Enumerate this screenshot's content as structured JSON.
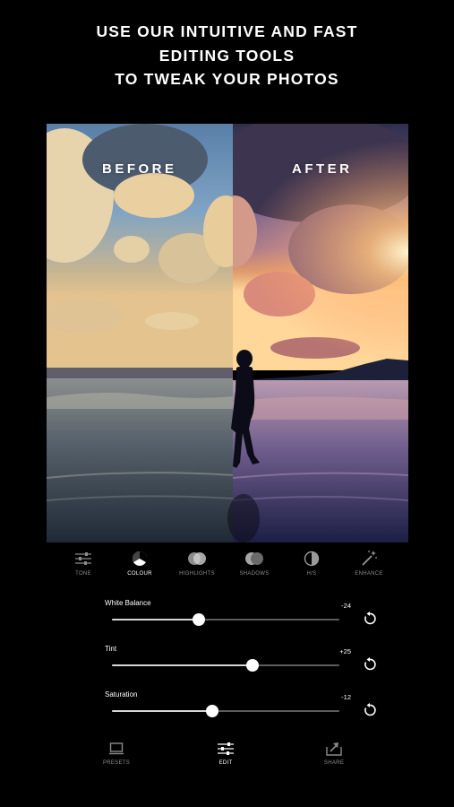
{
  "headline": {
    "line1": "USE OUR INTUITIVE AND FAST",
    "line2": "EDITING TOOLS",
    "line3": "TO TWEAK YOUR PHOTOS"
  },
  "comparison": {
    "before_label": "BEFORE",
    "after_label": "AFTER"
  },
  "tools": [
    {
      "label": "TONE",
      "icon": "sliders-icon",
      "active": false
    },
    {
      "label": "COLOUR",
      "icon": "colour-wheel-icon",
      "active": true
    },
    {
      "label": "HIGHLIGHTS",
      "icon": "highlights-icon",
      "active": false
    },
    {
      "label": "SHADOWS",
      "icon": "shadows-icon",
      "active": false
    },
    {
      "label": "H/S",
      "icon": "half-circle-icon",
      "active": false
    },
    {
      "label": "ENHANCE",
      "icon": "magic-wand-icon",
      "active": false
    }
  ],
  "sliders": [
    {
      "name": "White Balance",
      "value": "-24",
      "position": 0.38
    },
    {
      "name": "Tint",
      "value": "+25",
      "position": 0.62
    },
    {
      "name": "Saturation",
      "value": "-12",
      "position": 0.44
    }
  ],
  "bottom_nav": [
    {
      "label": "PRESETS",
      "icon": "presets-icon",
      "active": false
    },
    {
      "label": "EDIT",
      "icon": "edit-sliders-icon",
      "active": true
    },
    {
      "label": "SHARE",
      "icon": "share-icon",
      "active": false
    }
  ],
  "colors": {
    "background": "#000000",
    "text": "#ffffff",
    "inactive_label": "#8b8b8b",
    "slider_track": "#5c5c5c",
    "slider_fill": "#d6d6d6"
  }
}
